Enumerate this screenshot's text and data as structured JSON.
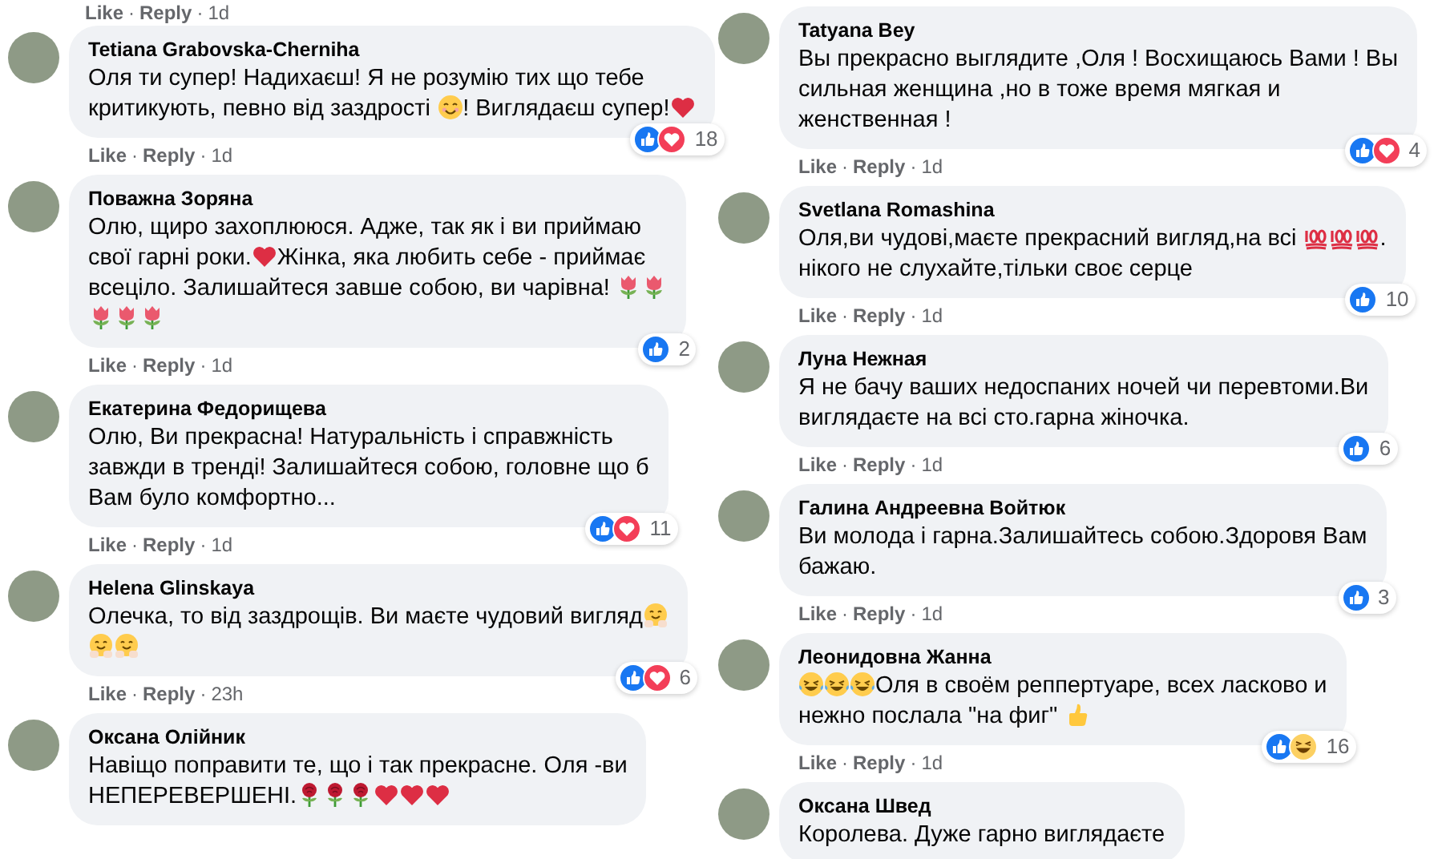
{
  "columns": [
    {
      "top_meta": {
        "like": "Like",
        "separator": "·",
        "reply": "Reply",
        "time": "1d"
      },
      "comments": [
        {
          "name": "Tetiana Grabovska-Cherniha",
          "lines": [
            [
              {
                "kind": "text",
                "text": "Оля ти супер! Надихаєш! Я не розумію тих що тебе"
              }
            ],
            [
              {
                "kind": "text",
                "text": "критикують, певно від заздрості "
              },
              {
                "kind": "smile"
              },
              {
                "kind": "text",
                "text": "! Виглядаєш супер!"
              },
              {
                "kind": "heart"
              }
            ]
          ],
          "reactions": {
            "icons": [
              {
                "kind": "like"
              },
              {
                "kind": "love"
              }
            ],
            "count": "18"
          },
          "meta": {
            "like": "Like",
            "separator": "·",
            "reply": "Reply",
            "time": "1d"
          }
        },
        {
          "name": "Поважна Зоряна",
          "lines": [
            [
              {
                "kind": "text",
                "text": "Олю, щиро захоплююся. Адже, так як і ви приймаю"
              }
            ],
            [
              {
                "kind": "text",
                "text": "свої гарні роки."
              },
              {
                "kind": "heart"
              },
              {
                "kind": "text",
                "text": "Жінка, яка любить себе - приймає"
              }
            ],
            [
              {
                "kind": "text",
                "text": "всеціло. Залишайтеся завше собою, ви чарівна! "
              },
              {
                "kind": "tulip"
              },
              {
                "kind": "tulip"
              }
            ],
            [
              {
                "kind": "tulip"
              },
              {
                "kind": "tulip"
              },
              {
                "kind": "tulip"
              }
            ]
          ],
          "reactions": {
            "icons": [
              {
                "kind": "like"
              }
            ],
            "count": "2"
          },
          "meta": {
            "like": "Like",
            "separator": "·",
            "reply": "Reply",
            "time": "1d"
          }
        },
        {
          "name": "Екатерина Федорищева",
          "lines": [
            [
              {
                "kind": "text",
                "text": "Олю, Ви прекрасна! Натуральність і справжність"
              }
            ],
            [
              {
                "kind": "text",
                "text": "завжди в тренді! Залишайтеся собою, головне що б"
              }
            ],
            [
              {
                "kind": "text",
                "text": "Вам було комфортно..."
              }
            ]
          ],
          "reactions": {
            "icons": [
              {
                "kind": "like"
              },
              {
                "kind": "love"
              }
            ],
            "count": "11"
          },
          "meta": {
            "like": "Like",
            "separator": "·",
            "reply": "Reply",
            "time": "1d"
          }
        },
        {
          "name": "Helena Glinskaya",
          "lines": [
            [
              {
                "kind": "text",
                "text": "Олечка, то від заздрощів. Ви маєте чудовий вигляд"
              },
              {
                "kind": "hug"
              }
            ],
            [
              {
                "kind": "hug"
              },
              {
                "kind": "hug"
              }
            ]
          ],
          "reactions": {
            "icons": [
              {
                "kind": "like"
              },
              {
                "kind": "love"
              }
            ],
            "count": "6"
          },
          "meta": {
            "like": "Like",
            "separator": "·",
            "reply": "Reply",
            "time": "23h"
          }
        },
        {
          "name": "Оксана Олійник",
          "lines": [
            [
              {
                "kind": "text",
                "text": "Навіщо поправити те, що і так прекрасне. Оля -ви"
              }
            ],
            [
              {
                "kind": "text",
                "text": "НЕПЕРЕВЕРШЕНІ."
              },
              {
                "kind": "rose"
              },
              {
                "kind": "rose"
              },
              {
                "kind": "rose"
              },
              {
                "kind": "heart"
              },
              {
                "kind": "heart"
              },
              {
                "kind": "heart"
              }
            ]
          ]
        }
      ]
    },
    {
      "comments": [
        {
          "name": "Tatyana Bey",
          "lines": [
            [
              {
                "kind": "text",
                "text": "Вы прекрасно выглядите ,Оля ! Восхищаюсь Вами ! Вы"
              }
            ],
            [
              {
                "kind": "text",
                "text": "сильная женщина ,но в тоже время мягкая и"
              }
            ],
            [
              {
                "kind": "text",
                "text": "женственная !"
              }
            ]
          ],
          "reactions": {
            "icons": [
              {
                "kind": "like"
              },
              {
                "kind": "love"
              }
            ],
            "count": "4"
          },
          "meta": {
            "like": "Like",
            "separator": "·",
            "reply": "Reply",
            "time": "1d"
          }
        },
        {
          "name": "Svetlana Romashina",
          "lines": [
            [
              {
                "kind": "text",
                "text": "Оля,ви чудові,маєте прекрасний вигляд,на всі "
              },
              {
                "kind": "hundred"
              },
              {
                "kind": "hundred"
              },
              {
                "kind": "hundred"
              },
              {
                "kind": "text",
                "text": "."
              }
            ],
            [
              {
                "kind": "text",
                "text": "нікого не слухайте,тільки своє серце"
              }
            ]
          ],
          "reactions": {
            "icons": [
              {
                "kind": "like"
              }
            ],
            "count": "10"
          },
          "meta": {
            "like": "Like",
            "separator": "·",
            "reply": "Reply",
            "time": "1d"
          }
        },
        {
          "name": "Луна Нежная",
          "lines": [
            [
              {
                "kind": "text",
                "text": "Я не бачу ваших недоспаних ночей чи перевтоми.Ви"
              }
            ],
            [
              {
                "kind": "text",
                "text": "виглядаєте на всі сто.гарна жіночка."
              }
            ]
          ],
          "reactions": {
            "icons": [
              {
                "kind": "like"
              }
            ],
            "count": "6"
          },
          "meta": {
            "like": "Like",
            "separator": "·",
            "reply": "Reply",
            "time": "1d"
          }
        },
        {
          "name": "Галина Андреевна Войтюк",
          "lines": [
            [
              {
                "kind": "text",
                "text": "Ви молода і гарна.Залишайтесь собою.Здоровя Вам"
              }
            ],
            [
              {
                "kind": "text",
                "text": "бажаю."
              }
            ]
          ],
          "reactions": {
            "icons": [
              {
                "kind": "like"
              }
            ],
            "count": "3"
          },
          "meta": {
            "like": "Like",
            "separator": "·",
            "reply": "Reply",
            "time": "1d"
          }
        },
        {
          "name": "Леонидовна Жанна",
          "lines": [
            [
              {
                "kind": "laugh"
              },
              {
                "kind": "laugh"
              },
              {
                "kind": "laugh"
              },
              {
                "kind": "text",
                "text": "Оля в своём реппертуаре, всех ласково и"
              }
            ],
            [
              {
                "kind": "text",
                "text": "нежно послала \"на фиг\" "
              },
              {
                "kind": "thumb"
              }
            ]
          ],
          "reactions": {
            "icons": [
              {
                "kind": "like"
              },
              {
                "kind": "haha"
              }
            ],
            "count": "16"
          },
          "meta": {
            "like": "Like",
            "separator": "·",
            "reply": "Reply",
            "time": "1d"
          }
        },
        {
          "name": "Оксана Швед",
          "lines": [
            [
              {
                "kind": "text",
                "text": "Королева. Дуже гарно виглядаєте"
              }
            ]
          ]
        }
      ]
    }
  ]
}
